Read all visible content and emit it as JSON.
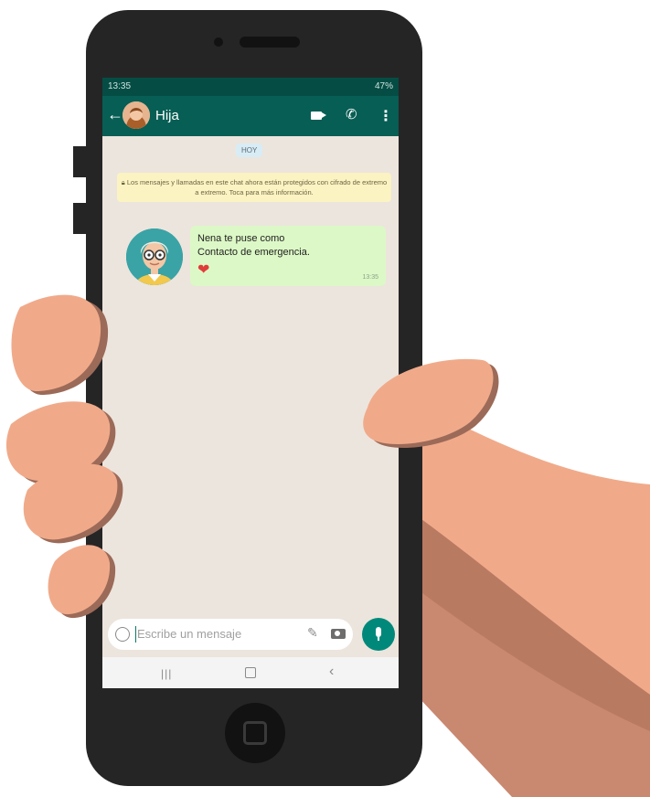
{
  "status_bar": {
    "time": "13:35",
    "indicators": "47%"
  },
  "chat_header": {
    "back_icon": "arrow-left-icon",
    "contact_name": "Hija"
  },
  "conversation": {
    "date_chip": "HOY",
    "encryption_notice": "Los mensajes y llamadas en este chat ahora están protegidos con cifrado de extremo a extremo. Toca para más información.",
    "message": {
      "text": "Nena te puse como\nContacto de emergencia.",
      "emoji": "❤",
      "time": "13:35"
    }
  },
  "composer": {
    "placeholder": "Escribe un mensaje"
  },
  "nav_bar": {
    "recent_glyph": "|||",
    "back_glyph": "‹"
  },
  "colors": {
    "header_green": "#075e54",
    "bubble_green": "#dcf8c6",
    "chat_bg": "#ece5dd",
    "mic_button": "#00897b",
    "skin": "#f0aa8a",
    "phone_body": "#252526"
  }
}
